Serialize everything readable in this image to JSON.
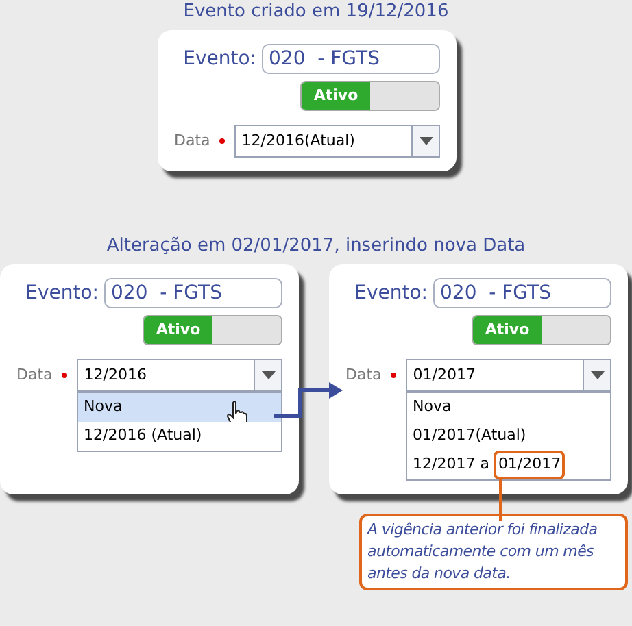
{
  "top_caption": "Evento criado em 19/12/2016",
  "first_card": {
    "evento_label": "Evento:",
    "evento_value": "020  - FGTS",
    "toggle": {
      "label": "Ativo",
      "on": true
    },
    "data_label": "Data",
    "data_value": "12/2016(Atual)"
  },
  "middle_caption": "Alteração em 02/01/2017, inserindo nova Data",
  "cards": [
    {
      "evento_label": "Evento:",
      "evento_value": "020  - FGTS",
      "toggle": {
        "label": "Ativo",
        "on": true
      },
      "data_label": "Data",
      "data_value": "12/2016",
      "dropdown": {
        "options": [
          {
            "label": "Nova",
            "selected": true
          },
          {
            "label": "12/2016 (Atual)",
            "selected": false
          }
        ]
      }
    },
    {
      "evento_label": "Evento:",
      "evento_value": "020  - FGTS",
      "toggle": {
        "label": "Ativo",
        "on": true
      },
      "data_label": "Data",
      "data_value": "01/2017",
      "dropdown": {
        "options": [
          {
            "label": "Nova",
            "selected": false
          },
          {
            "label": "01/2017(Atual)",
            "selected": false
          },
          {
            "label": "12/2017 a",
            "circled": "01/2017",
            "selected": false
          }
        ]
      }
    }
  ],
  "callout": "A vigência anterior foi finalizada automaticamente com um mês antes da nova data."
}
